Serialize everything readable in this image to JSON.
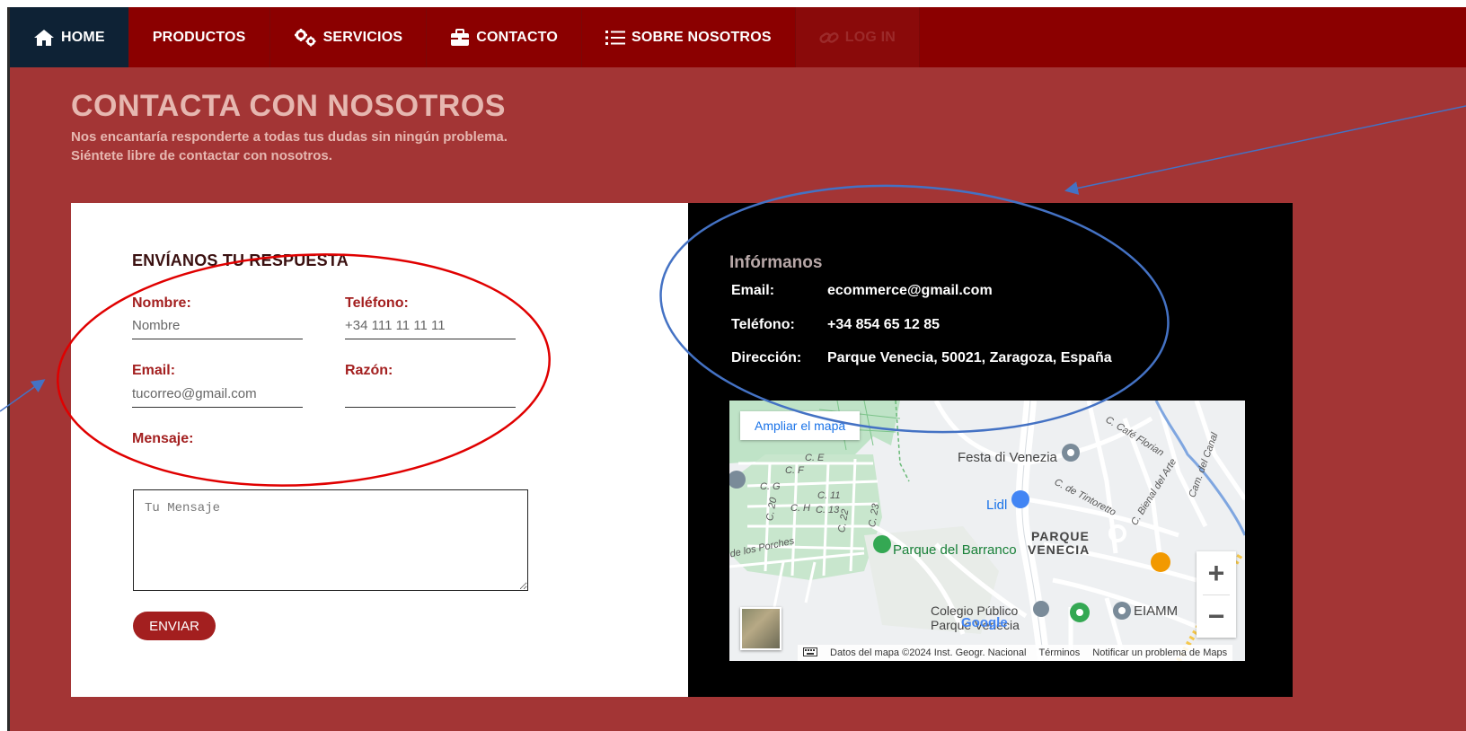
{
  "nav": {
    "items": [
      {
        "label": "HOME",
        "icon": "home-icon"
      },
      {
        "label": "PRODUCTOS"
      },
      {
        "label": "SERVICIOS",
        "icon": "gears-icon"
      },
      {
        "label": "CONTACTO",
        "icon": "briefcase-icon"
      },
      {
        "label": "SOBRE NOSOTROS",
        "icon": "list-icon"
      },
      {
        "label": "LOG IN",
        "icon": "link-icon"
      }
    ]
  },
  "hero": {
    "title": "CONTACTA CON NOSOTROS",
    "line1": "Nos encantaría responderte a todas tus dudas sin ningún problema.",
    "line2": "Siéntete libre de contactar con nosotros."
  },
  "form": {
    "title": "ENVÍANOS TU RESPUESTA",
    "name_label": "Nombre:",
    "name_placeholder": "Nombre",
    "phone_label": "Teléfono:",
    "phone_placeholder": "+34 111 11 11 11",
    "email_label": "Email:",
    "email_placeholder": "tucorreo@gmail.com",
    "reason_label": "Razón:",
    "message_label": "Mensaje:",
    "message_placeholder": "Tu Mensaje",
    "send_label": "ENVIAR"
  },
  "info": {
    "title": "Infórmanos",
    "email_key": "Email:",
    "email_value": "ecommerce@gmail.com",
    "phone_key": "Teléfono:",
    "phone_value": "+34 854 65 12 85",
    "address_key": "Dirección:",
    "address_value": "Parque Venecia, 50021, Zaragoza, España"
  },
  "map": {
    "enlarge_label": "Ampliar el mapa",
    "zoom_in": "+",
    "zoom_out": "−",
    "labels": {
      "festa": "Festa di Venezia",
      "lidl": "Lidl",
      "parque_venecia_1": "PARQUE",
      "parque_venecia_2": "VENECIA",
      "barranco": "Parque del Barranco",
      "colegio_1": "Colegio Público",
      "colegio_2": "Parque Venecia",
      "eiamm": "EIAMM",
      "porches": "de los Porches",
      "florian": "C. Café Florian",
      "tintoretto": "C. de Tintoretto",
      "bienal": "C. Bienal del Arte",
      "canal": "Cam. del Canal",
      "ce": "C. E",
      "cf": "C. F",
      "cg": "C. G",
      "ch": "C. H",
      "c11": "C. 11",
      "c13": "C. 13",
      "c20": "C. 20",
      "c22": "C. 22",
      "c23": "C. 23",
      "google": "Google"
    },
    "footer": {
      "data": "Datos del mapa ©2024 Inst. Geogr. Nacional",
      "terms": "Términos",
      "report": "Notificar un problema de Maps"
    }
  },
  "colors": {
    "nav_bg": "#8b0000",
    "nav_active": "#0e2235",
    "page_bg": "#a33535",
    "accent": "#a31f1f",
    "annotation_red": "#e00000",
    "annotation_blue": "#4472c4"
  }
}
